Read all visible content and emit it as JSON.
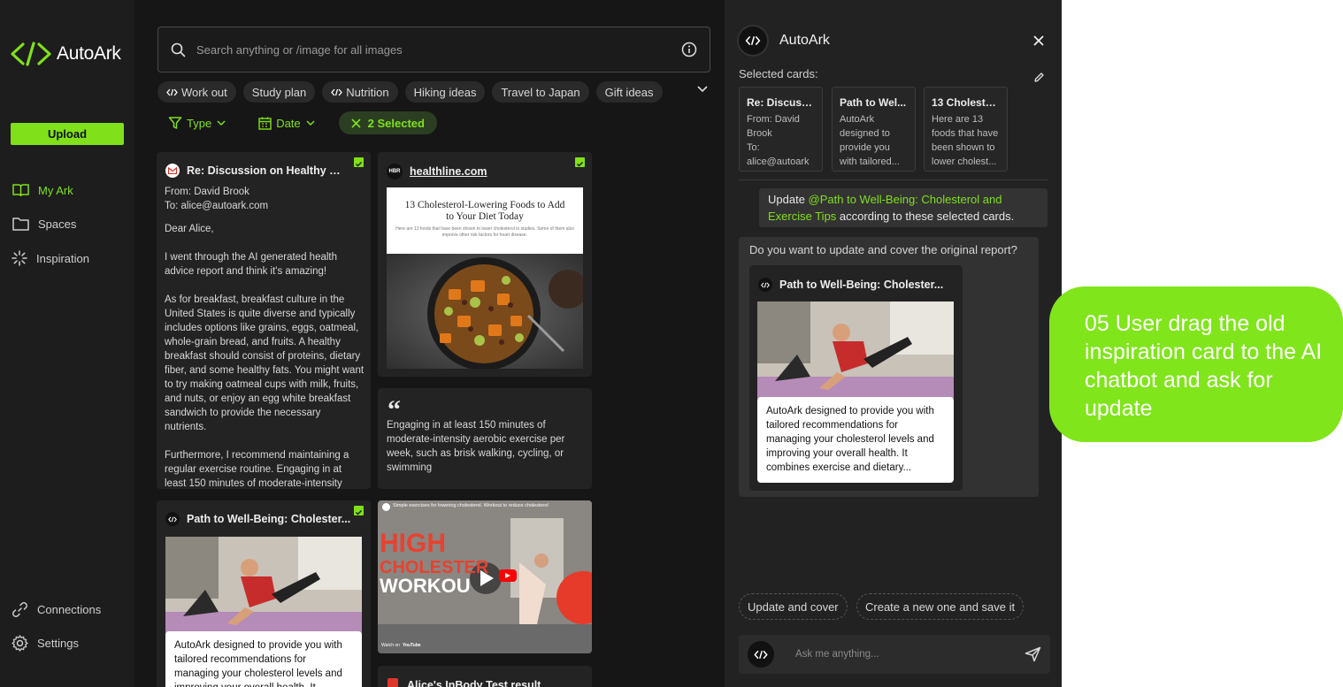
{
  "brand": {
    "name": "AutoArk",
    "accent": "#80e01a"
  },
  "sidebar": {
    "upload_label": "Upload",
    "nav": [
      {
        "label": "My Ark",
        "icon": "book-open-icon",
        "active": true
      },
      {
        "label": "Spaces",
        "icon": "folder-icon"
      },
      {
        "label": "Inspiration",
        "icon": "sparkle-loader-icon"
      }
    ],
    "bottom_nav": [
      {
        "label": "Connections",
        "icon": "link-icon"
      },
      {
        "label": "Settings",
        "icon": "gear-icon"
      }
    ]
  },
  "search": {
    "placeholder": "Search anything or /image for all images"
  },
  "chips": [
    "Work out",
    "Study plan",
    "Nutrition",
    "Hiking ideas",
    "Travel to Japan",
    "Gift ideas"
  ],
  "filters": {
    "type_label": "Type",
    "date_label": "Date",
    "selected_label": "2 Selected"
  },
  "cards": {
    "email": {
      "title": "Re: Discussion on Healthy Eat...",
      "from": "From: David Brook",
      "to": "To: alice@autoark.com",
      "greeting": "Dear Alice,",
      "p1": " I went through the AI generated health advice report and think it's amazing!",
      "p2": "As for breakfast, breakfast culture in the United States is quite diverse and typically includes options like grains, eggs, oatmeal, whole-grain bread, and fruits. A healthy breakfast should consist of proteins, dietary fiber, and some healthy fats. You might want to try making oatmeal cups with milk, fruits, and nuts, or enjoy an egg white breakfast sandwich to provide the necessary nutrients.",
      "p3": "Furthermore, I recommend maintaining a regular exercise routine. Engaging in at least 150 minutes of moderate-intensity"
    },
    "article": {
      "source_badge": "HBR",
      "source": "healthline.com",
      "headline": "13 Cholesterol-Lowering Foods to Add to Your Diet Today",
      "subhead": "Here are 13 foods that have been shown to lower cholesterol in studies. Some of them also improve other risk factors for heart disease."
    },
    "quote": {
      "mark": "“",
      "text": "Engaging in at least 150 minutes of moderate-intensity aerobic exercise per week, such as brisk walking, cycling, or swimming"
    },
    "report": {
      "title": "Path to Well-Being: Cholester...",
      "text": "AutoArk designed to provide you with tailored recommendations for managing your cholesterol levels and improving your overall health. It"
    },
    "video": {
      "caption": "Simple exercises for lowering cholesterol. Workout to reduce cholesterol",
      "line1": "HIGH",
      "line2": "CHOLESTER",
      "line3": "WORKOU",
      "watch_on": "Watch on",
      "platform": "YouTube"
    },
    "pdf": {
      "title": "Alice's InBody Test result"
    }
  },
  "panel": {
    "title": "AutoArk",
    "selected_label": "Selected cards:",
    "selected_cards": [
      {
        "title": "Re: Discussi...",
        "body": "From: David\nBrook\nTo:\nalice@autoark"
      },
      {
        "title": "Path to Wel...",
        "body": "AutoArk\ndesigned to\nprovide you\nwith tailored..."
      },
      {
        "title": "13 Choleste...",
        "body": "Here are 13\nfoods that have\nbeen shown to\nlower cholest..."
      }
    ],
    "user_message": {
      "prefix": "Update ",
      "mention": "@Path to Well-Being: Cholesterol and Exercise Tips",
      "suffix": " according to these selected cards."
    },
    "bot_message": {
      "question": "Do you want to update and cover the original report?",
      "card_title": "Path to Well-Being: Cholester...",
      "card_text": "AutoArk designed to provide you with tailored recommendations for managing your cholesterol levels and improving your overall health. It combines exercise and dietary..."
    },
    "actions": [
      "Update and cover",
      "Create a new one and save it"
    ],
    "ask_placeholder": "Ask me anything..."
  },
  "annotation": {
    "text": "05 User drag the old inspiration card to the AI chatbot and ask for update",
    "color": "#80e51b"
  }
}
